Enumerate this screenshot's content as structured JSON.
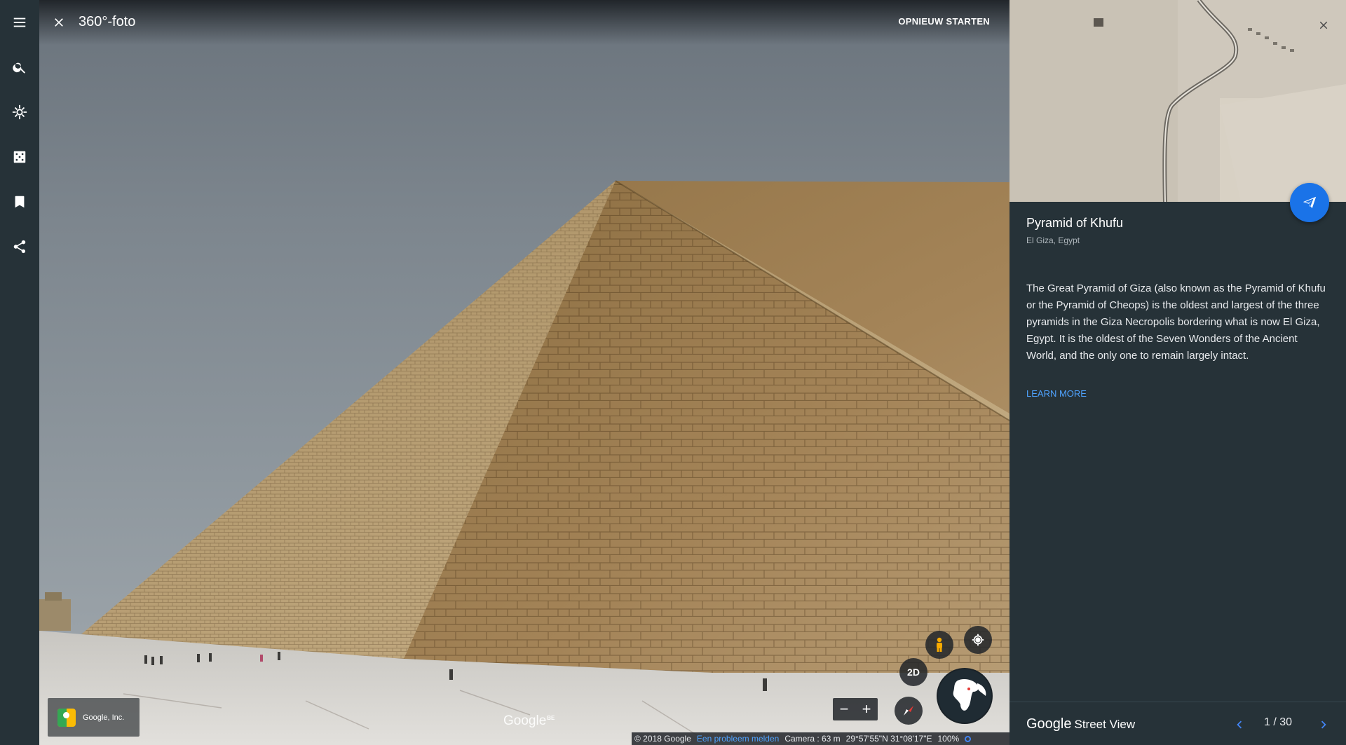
{
  "viewer": {
    "title": "360°-foto",
    "restart_label": "OPNIEUW STARTEN",
    "attribution": "Google, Inc.",
    "google_logo": "Google",
    "google_logo_region": "BE",
    "zoom_out": "−",
    "zoom_in": "+",
    "view_mode": "2D"
  },
  "sidebar": {
    "items": [
      {
        "icon": "menu-icon"
      },
      {
        "icon": "search-icon"
      },
      {
        "icon": "voyager-icon"
      },
      {
        "icon": "feeling-lucky-icon"
      },
      {
        "icon": "bookmark-icon"
      },
      {
        "icon": "share-icon"
      }
    ]
  },
  "status": {
    "copyright": "© 2018 Google",
    "report": "Een probleem melden",
    "camera": "Camera :  63 m",
    "coords": "29°57'55\"N 31°08'17\"E",
    "zoom": "100%"
  },
  "panel": {
    "title": "Pyramid of Khufu",
    "subtitle": "El Giza, Egypt",
    "description": "The Great Pyramid of Giza (also known as the Pyramid of Khufu or the Pyramid of Cheops) is the oldest and largest of the three pyramids in the Giza Necropolis bordering what is now El Giza, Egypt. It is the oldest of the Seven Wonders of the Ancient World, and the only one to remain largely intact.",
    "learn_more": "LEARN MORE",
    "brand_google": "Google",
    "brand_product": "Street View",
    "pager": "1 / 30"
  },
  "colors": {
    "panel_bg": "#263238",
    "accent": "#1a73e8",
    "link": "#4fa3ff"
  }
}
